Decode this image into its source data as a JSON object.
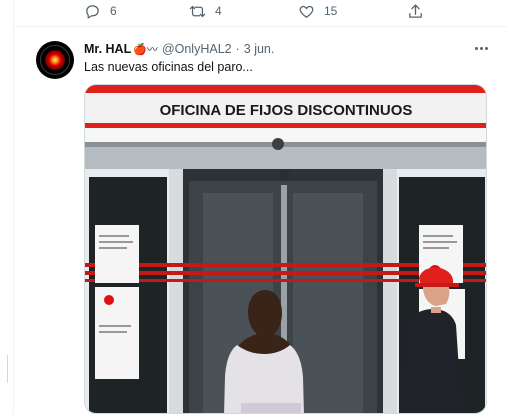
{
  "previous_tweet": {
    "actions": {
      "reply_count": "6",
      "retweet_count": "4",
      "like_count": "15"
    }
  },
  "tweet": {
    "author_name": "Mr. HAL",
    "author_emoji": "🍎〰",
    "handle": "@OnlyHAL2",
    "separator": "·",
    "date": "3 jun.",
    "text": "Las nuevas oficinas del paro...",
    "media": {
      "sign_text": "OFICINA DE FIJOS DISCONTINUOS"
    }
  },
  "colors": {
    "accent_red": "#e0201c",
    "muted_text": "#536471",
    "divider": "#eff3f4"
  },
  "icons": [
    "reply-icon",
    "retweet-icon",
    "like-icon",
    "share-icon",
    "more-icon"
  ]
}
